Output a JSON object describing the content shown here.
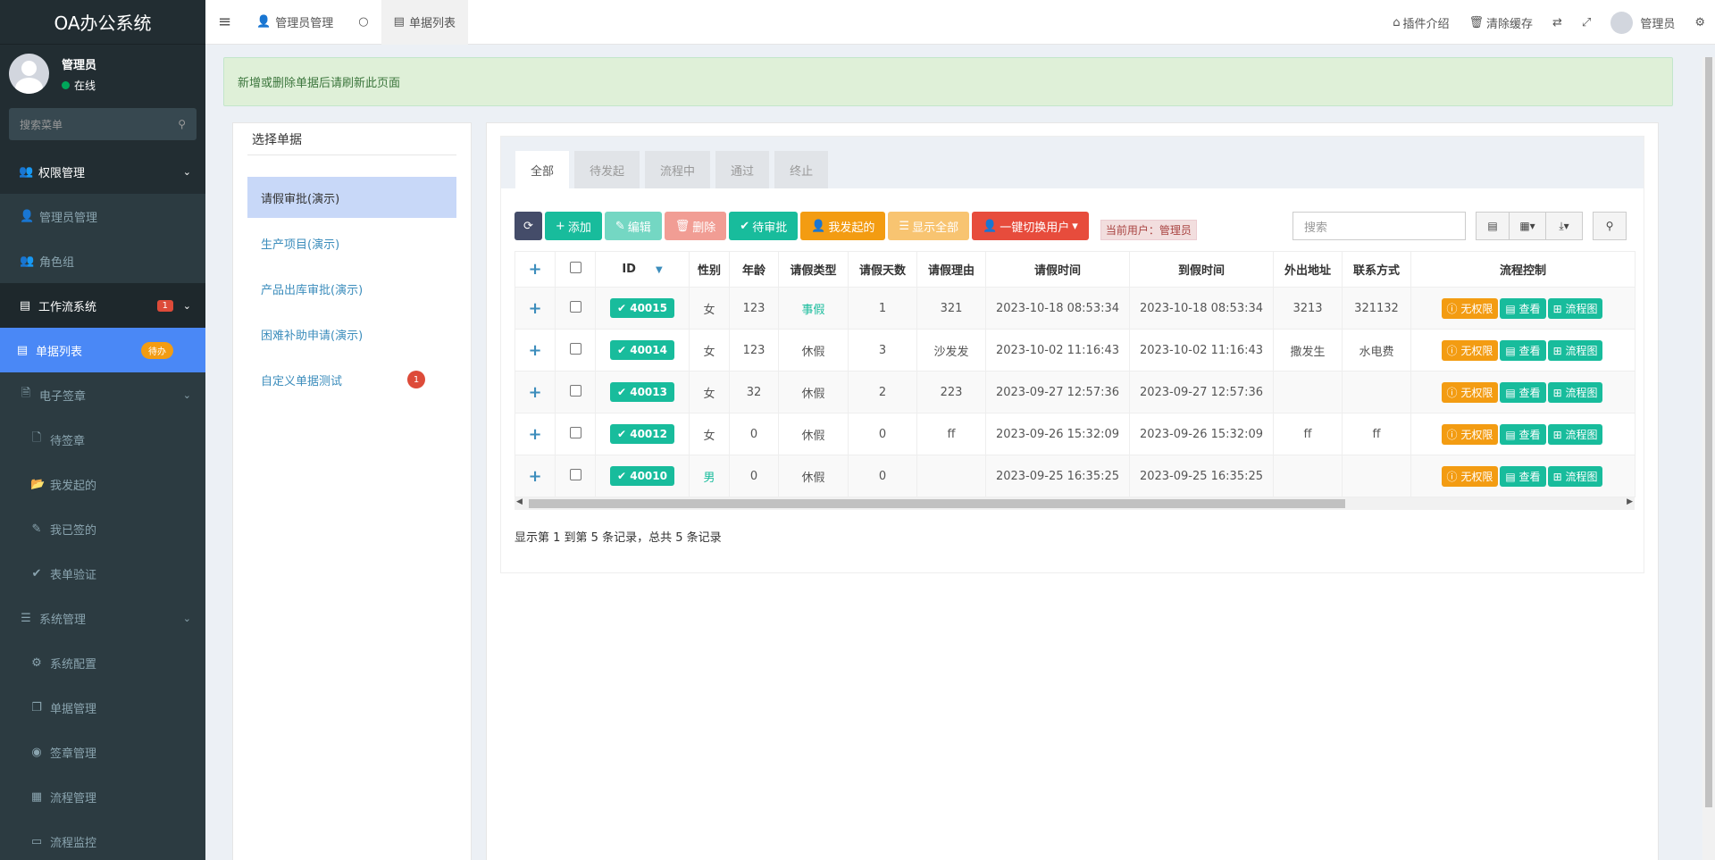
{
  "app": {
    "title": "OA办公系统"
  },
  "user": {
    "name": "管理员",
    "status": "在线"
  },
  "sidebar": {
    "search_placeholder": "搜索菜单",
    "items": [
      {
        "label": "权限管理"
      },
      {
        "label": "管理员管理"
      },
      {
        "label": "角色组"
      },
      {
        "label": "工作流系统",
        "badge": "1"
      },
      {
        "label": "单据列表",
        "badge": "待办"
      },
      {
        "label": "电子签章"
      },
      {
        "label": "待签章"
      },
      {
        "label": "我发起的"
      },
      {
        "label": "我已签的"
      },
      {
        "label": "表单验证"
      },
      {
        "label": "系统管理"
      },
      {
        "label": "系统配置"
      },
      {
        "label": "单据管理"
      },
      {
        "label": "签章管理"
      },
      {
        "label": "流程管理"
      },
      {
        "label": "流程监控"
      }
    ]
  },
  "topbar": {
    "tab1": "管理员管理",
    "tab2": "单据列表",
    "plugin": "插件介绍",
    "clear_cache": "清除缓存",
    "user": "管理员"
  },
  "alert": "新增或删除单据后请刷新此页面",
  "left_panel": {
    "title": "选择单据",
    "items": [
      {
        "label": "请假审批(演示)"
      },
      {
        "label": "生产项目(演示)"
      },
      {
        "label": "产品出库审批(演示)"
      },
      {
        "label": "困难补助申请(演示)"
      },
      {
        "label": "自定义单据测试",
        "badge": "1"
      }
    ]
  },
  "tabs": [
    "全部",
    "待发起",
    "流程中",
    "通过",
    "终止"
  ],
  "toolbar": {
    "add": "添加",
    "edit": "编辑",
    "delete": "删除",
    "pending": "待审批",
    "mine": "我发起的",
    "show_all": "显示全部",
    "switch_user": "一键切换用户",
    "current_user": "当前用户：管理员",
    "search_placeholder": "搜索"
  },
  "table": {
    "headers": [
      "ID",
      "性别",
      "年龄",
      "请假类型",
      "请假天数",
      "请假理由",
      "请假时间",
      "到假时间",
      "外出地址",
      "联系方式",
      "流程控制"
    ],
    "rows": [
      {
        "id": "40015",
        "sex": "女",
        "age": "123",
        "type": "事假",
        "days": "1",
        "reason": "321",
        "start": "2023-10-18 08:53:34",
        "end": "2023-10-18 08:53:34",
        "addr": "3213",
        "contact": "321132"
      },
      {
        "id": "40014",
        "sex": "女",
        "age": "123",
        "type": "休假",
        "days": "3",
        "reason": "沙发发",
        "start": "2023-10-02 11:16:43",
        "end": "2023-10-02 11:16:43",
        "addr": "撒发生",
        "contact": "水电费"
      },
      {
        "id": "40013",
        "sex": "女",
        "age": "32",
        "type": "休假",
        "days": "2",
        "reason": "223",
        "start": "2023-09-27 12:57:36",
        "end": "2023-09-27 12:57:36",
        "addr": "",
        "contact": ""
      },
      {
        "id": "40012",
        "sex": "女",
        "age": "0",
        "type": "休假",
        "days": "0",
        "reason": "ff",
        "start": "2023-09-26 15:32:09",
        "end": "2023-09-26 15:32:09",
        "addr": "ff",
        "contact": "ff"
      },
      {
        "id": "40010",
        "sex": "男",
        "age": "0",
        "type": "休假",
        "days": "0",
        "reason": "",
        "start": "2023-09-25 16:35:25",
        "end": "2023-09-25 16:35:25",
        "addr": "",
        "contact": ""
      }
    ],
    "actions": {
      "no_perm": "无权限",
      "view": "查看",
      "flow": "流程图"
    }
  },
  "pager": "显示第 1 到第 5 条记录，总共 5 条记录",
  "colors": {
    "sidebar": "#222d32",
    "active": "#4a88f6",
    "success": "#18bc9c",
    "warning": "#f39c12",
    "danger": "#e74c3c"
  }
}
